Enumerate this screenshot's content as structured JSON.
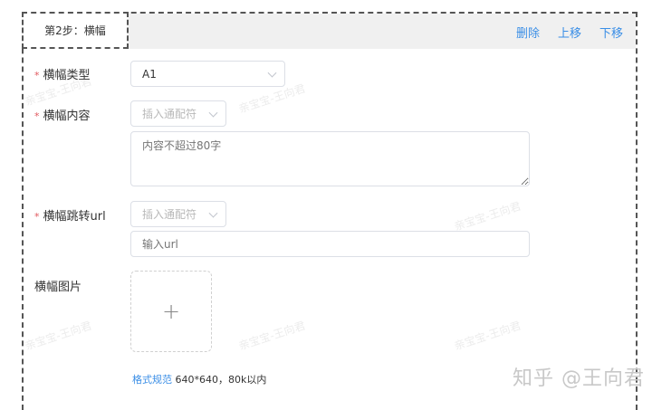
{
  "step_tab": {
    "label": "第2步：横幅"
  },
  "actions": {
    "delete": "删除",
    "move_up": "上移",
    "move_down": "下移"
  },
  "form": {
    "banner_type": {
      "label": "横幅类型",
      "required": true,
      "value": "A1"
    },
    "banner_content": {
      "label": "横幅内容",
      "required": true,
      "wildcard_placeholder": "插入通配符",
      "textarea_placeholder": "内容不超过80字"
    },
    "banner_url": {
      "label": "横幅跳转url",
      "required": true,
      "wildcard_placeholder": "插入通配符",
      "input_placeholder": "输入url"
    },
    "banner_image": {
      "label": "横幅图片",
      "upload_icon": "plus-icon",
      "hint_link": "格式规范",
      "hint_text": "640*640，80k以内"
    }
  },
  "watermark": "亲宝宝-王向君",
  "site_watermark": "知乎 @王向君",
  "colors": {
    "link": "#3a8ee6",
    "required": "#e0585e"
  }
}
